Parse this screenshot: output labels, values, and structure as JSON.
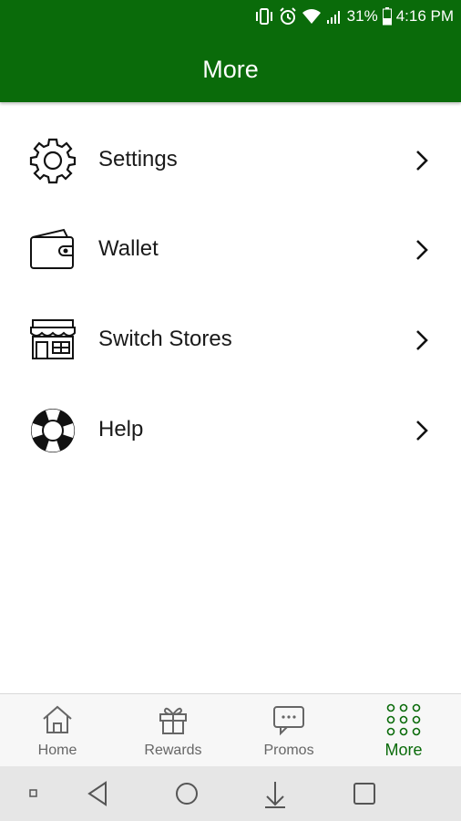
{
  "status_bar": {
    "battery_percent": "31%",
    "time": "4:16 PM"
  },
  "header": {
    "title": "More",
    "background": "#0a6b0a"
  },
  "menu": {
    "items": [
      {
        "label": "Settings",
        "icon": "gear-icon"
      },
      {
        "label": "Wallet",
        "icon": "wallet-icon"
      },
      {
        "label": "Switch Stores",
        "icon": "storefront-icon"
      },
      {
        "label": "Help",
        "icon": "lifebuoy-icon"
      }
    ]
  },
  "bottom_nav": {
    "items": [
      {
        "label": "Home",
        "icon": "house-icon",
        "active": false
      },
      {
        "label": "Rewards",
        "icon": "gift-icon",
        "active": false
      },
      {
        "label": "Promos",
        "icon": "chat-bubble-icon",
        "active": false
      },
      {
        "label": "More",
        "icon": "grid-dots-icon",
        "active": true
      }
    ],
    "active_color": "#0a6b0a"
  },
  "system_nav": {
    "buttons": [
      "square-dot-icon",
      "back-triangle-icon",
      "home-circle-icon",
      "notification-pulldown-icon",
      "recents-square-icon"
    ]
  }
}
